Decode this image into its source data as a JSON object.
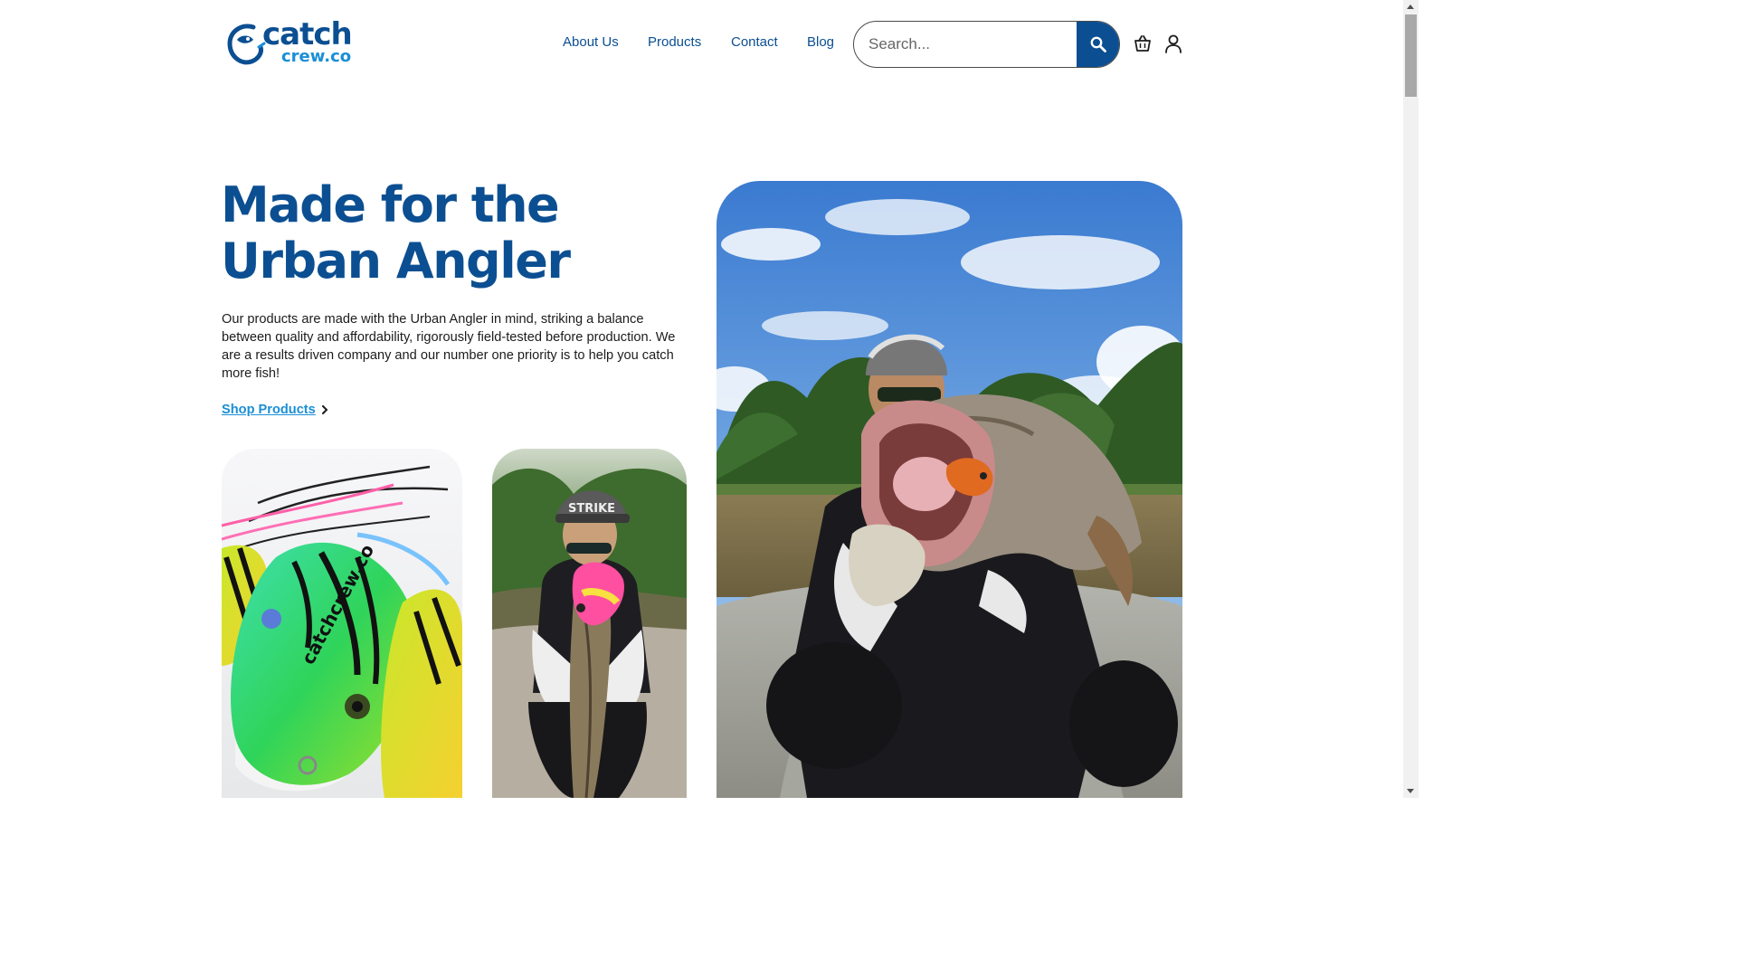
{
  "brand": {
    "logo_line1": "catch",
    "logo_line2": "crew.co",
    "primary_color": "#0b4f92",
    "accent_color": "#1a8fd6"
  },
  "nav": {
    "items": [
      {
        "label": "About Us"
      },
      {
        "label": "Products"
      },
      {
        "label": "Contact"
      },
      {
        "label": "Blog"
      }
    ]
  },
  "search": {
    "placeholder": "Search...",
    "value": "",
    "button_icon": "search-icon"
  },
  "header_icons": {
    "cart": "basket-icon",
    "account": "user-icon"
  },
  "hero": {
    "title": "Made for the Urban Angler",
    "description": "Our products are made with the Urban Angler in mind, striking a balance between quality and affordability, rigorously field-tested before production. We are a results driven company and our number one priority is to help you catch more fish!",
    "cta_label": "Shop Products",
    "cta_icon": "chevron-right-icon"
  },
  "images": {
    "lures_photo": "photo of colorful frog lures",
    "angler_snakehead_photo": "photo of angler holding snakehead fish",
    "angler_boat_photo": "photo of angler holding fish on boat"
  }
}
